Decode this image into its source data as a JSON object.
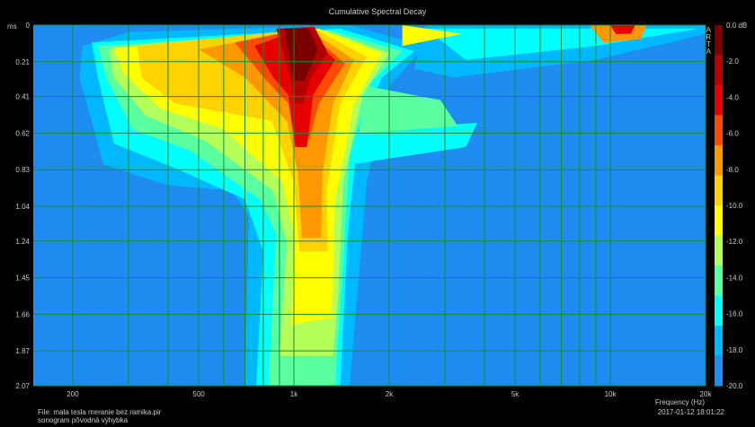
{
  "chart_data": {
    "type": "heatmap",
    "title": "Cumulative Spectral Decay",
    "xlabel": "Frequency (Hz)",
    "ylabel": "ms",
    "x_scale": "log",
    "xlim": [
      150,
      20000
    ],
    "ylim": [
      0,
      2.07
    ],
    "x_ticks": [
      {
        "value": 200,
        "label": "200"
      },
      {
        "value": 500,
        "label": "500"
      },
      {
        "value": 1000,
        "label": "1k"
      },
      {
        "value": 2000,
        "label": "2k"
      },
      {
        "value": 5000,
        "label": "5k"
      },
      {
        "value": 10000,
        "label": "10k"
      },
      {
        "value": 20000,
        "label": "20k"
      }
    ],
    "x_grid": [
      200,
      300,
      400,
      500,
      600,
      700,
      800,
      900,
      1000,
      2000,
      3000,
      4000,
      5000,
      6000,
      7000,
      8000,
      9000,
      10000,
      20000
    ],
    "y_ticks": [
      "0",
      "0.21",
      "0.41",
      "0.62",
      "0.83",
      "1.04",
      "1.24",
      "1.45",
      "1.66",
      "1.87",
      "2.07"
    ],
    "y_tick_values": [
      0,
      0.21,
      0.41,
      0.62,
      0.83,
      1.04,
      1.24,
      1.45,
      1.66,
      1.87,
      2.07
    ],
    "grid": true,
    "colorbar": {
      "unit": "dB",
      "labels": [
        "0.0 dB",
        "-2.0",
        "-4.0",
        "-6.0",
        "-8.0",
        "-10.0",
        "-12.0",
        "-14.0",
        "-16.0",
        "-18.0",
        "-20.0"
      ],
      "brand": "ARTA",
      "colors": [
        "#7a0000",
        "#b40000",
        "#e80000",
        "#ff4a00",
        "#ff9800",
        "#ffd200",
        "#ffff00",
        "#b4ff5a",
        "#5affa0",
        "#00ffff",
        "#00b8ff",
        "#1e8cf0"
      ]
    },
    "features": [
      {
        "name": "main resonance",
        "freq_hz": 1100,
        "level_db_at_0ms": 0,
        "decay": "persists past 2.07 ms at -14 to -18 dB"
      },
      {
        "name": "low-mid hump",
        "freq_hz_range": [
          280,
          900
        ],
        "time_ms_range": [
          0.21,
          0.83
        ],
        "level_db": -10
      },
      {
        "name": "upper resonance",
        "freq_hz": 11000,
        "time_ms_range": [
          0,
          0.5
        ],
        "level_db": -6
      }
    ]
  },
  "footer": {
    "file": "File: mala tesla meranie bez ramika.pir",
    "note": "sonogram pôvodná výhybka",
    "timestamp": "2017-01-12  18:01:22"
  }
}
